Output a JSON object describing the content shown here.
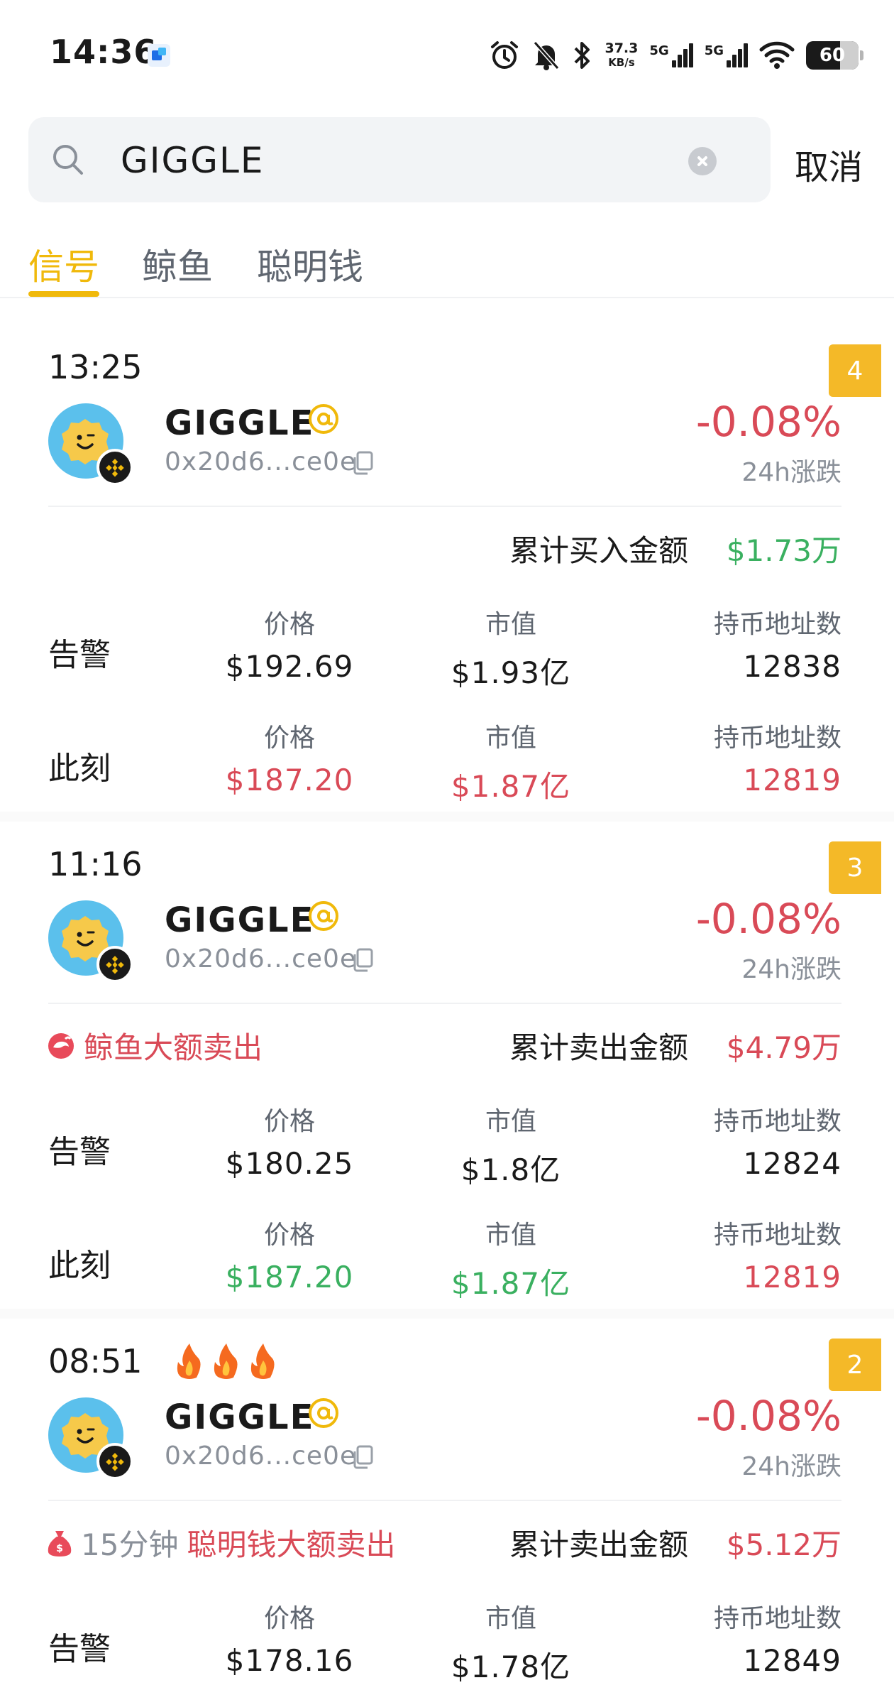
{
  "status_bar": {
    "time": "14:36",
    "net_speed": "37.3",
    "net_unit": "KB/s",
    "sim1": "5G",
    "sim2": "5G",
    "battery": "60",
    "icons": [
      "alarm-icon",
      "mute-icon",
      "bluetooth-icon",
      "wifi-icon"
    ]
  },
  "search": {
    "value": "GIGGLE",
    "cancel_label": "取消"
  },
  "tabs": [
    {
      "label": "信号",
      "active": true
    },
    {
      "label": "鲸鱼",
      "active": false
    },
    {
      "label": "聪明钱",
      "active": false
    }
  ],
  "labels": {
    "price": "价格",
    "market_cap": "市值",
    "holders": "持币地址数",
    "alert": "告警",
    "now": "此刻",
    "change_24h": "24h涨跌"
  },
  "colors": {
    "accent": "#f0b90b",
    "badge": "#f4b928",
    "up": "#3ab060",
    "down": "#d94a57",
    "muted": "#8a9099"
  },
  "cards": [
    {
      "time": "13:25",
      "rank": "4",
      "token": "GIGGLE",
      "address": "0x20d6...ce0e",
      "change": "-0.08%",
      "tag_prefix": "",
      "tag": "",
      "summary_label": "累计买入金额",
      "summary_value": "$1.73万",
      "alert": {
        "price": "$192.69",
        "mcap": "$1.93亿",
        "holders": "12838"
      },
      "now": {
        "price": "$187.20",
        "mcap": "$1.87亿",
        "holders": "12819"
      }
    },
    {
      "time": "11:16",
      "rank": "3",
      "token": "GIGGLE",
      "address": "0x20d6...ce0e",
      "change": "-0.08%",
      "tag_prefix": "",
      "tag": "鲸鱼大额卖出",
      "summary_label": "累计卖出金额",
      "summary_value": "$4.79万",
      "alert": {
        "price": "$180.25",
        "mcap": "$1.8亿",
        "holders": "12824"
      },
      "now": {
        "price": "$187.20",
        "mcap": "$1.87亿",
        "holders": "12819"
      }
    },
    {
      "time": "08:51",
      "rank": "2",
      "token": "GIGGLE",
      "address": "0x20d6...ce0e",
      "change": "-0.08%",
      "tag_prefix": "15分钟",
      "tag": "聪明钱大额卖出",
      "summary_label": "累计卖出金额",
      "summary_value": "$5.12万",
      "alert": {
        "price": "$178.16",
        "mcap": "$1.78亿",
        "holders": "12849"
      }
    }
  ]
}
